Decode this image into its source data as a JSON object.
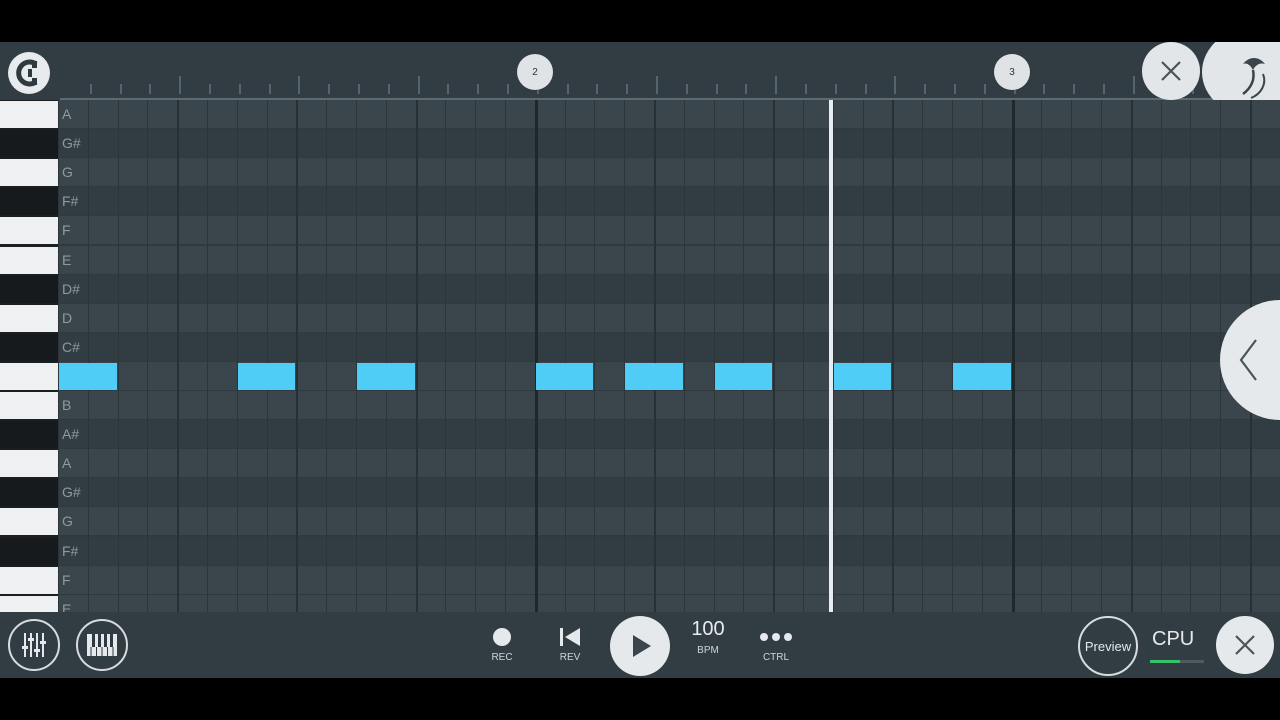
{
  "ruler": {
    "bar_markers": [
      "2",
      "3"
    ]
  },
  "piano_roll": {
    "rows": [
      {
        "label": "A",
        "type": "white"
      },
      {
        "label": "G#",
        "type": "black"
      },
      {
        "label": "G",
        "type": "white"
      },
      {
        "label": "F#",
        "type": "black"
      },
      {
        "label": "F",
        "type": "white"
      },
      {
        "label": "E",
        "type": "white"
      },
      {
        "label": "D#",
        "type": "black"
      },
      {
        "label": "D",
        "type": "white"
      },
      {
        "label": "C#",
        "type": "black"
      },
      {
        "label": "C",
        "type": "white"
      },
      {
        "label": "B",
        "type": "white"
      },
      {
        "label": "A#",
        "type": "black"
      },
      {
        "label": "A",
        "type": "white"
      },
      {
        "label": "G#",
        "type": "black"
      },
      {
        "label": "G",
        "type": "white"
      },
      {
        "label": "F#",
        "type": "black"
      },
      {
        "label": "F",
        "type": "white"
      },
      {
        "label": "E",
        "type": "white"
      }
    ],
    "steps_per_bar": 16,
    "notes": [
      {
        "pitch": "C",
        "step": 0,
        "length": 2
      },
      {
        "pitch": "C",
        "step": 6,
        "length": 2
      },
      {
        "pitch": "C",
        "step": 10,
        "length": 2
      },
      {
        "pitch": "C",
        "step": 16,
        "length": 2
      },
      {
        "pitch": "C",
        "step": 19,
        "length": 2
      },
      {
        "pitch": "C",
        "step": 22,
        "length": 2
      },
      {
        "pitch": "C",
        "step": 26,
        "length": 2
      },
      {
        "pitch": "C",
        "step": 30,
        "length": 2
      }
    ],
    "note_color": "#4fcdf6"
  },
  "transport": {
    "rec_label": "REC",
    "rev_label": "REV",
    "bpm_value": "100",
    "bpm_label": "BPM",
    "ctrl_label": "CTRL"
  },
  "right_controls": {
    "preview_label": "Preview",
    "cpu_label": "CPU",
    "cpu_level": 0.55
  },
  "icons": [
    "magnet-icon",
    "close-icon",
    "fruit-logo-icon",
    "chevron-left-icon",
    "mixer-icon",
    "piano-icon",
    "record-icon",
    "rewind-icon",
    "play-icon",
    "more-icon"
  ]
}
